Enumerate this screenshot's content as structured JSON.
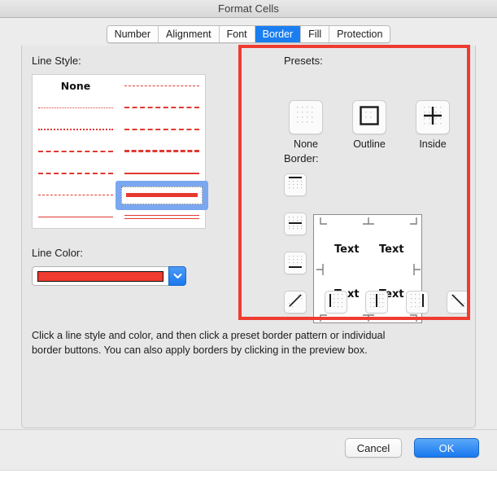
{
  "window": {
    "title": "Format Cells"
  },
  "tabs": [
    {
      "label": "Number",
      "active": false
    },
    {
      "label": "Alignment",
      "active": false
    },
    {
      "label": "Font",
      "active": false
    },
    {
      "label": "Border",
      "active": true
    },
    {
      "label": "Fill",
      "active": false
    },
    {
      "label": "Protection",
      "active": false
    }
  ],
  "line_style": {
    "label": "Line Style:",
    "none_label": "None",
    "selected_index": 11,
    "options": [
      {
        "index": 0,
        "name": "none",
        "style": "none"
      },
      {
        "index": 1,
        "name": "dash-dot-dot-fine",
        "style": "dash-dot-dot"
      },
      {
        "index": 2,
        "name": "dotted-fine",
        "style": "dotted-fine"
      },
      {
        "index": 3,
        "name": "dashed-medium",
        "style": "dashed-medium"
      },
      {
        "index": 4,
        "name": "dotted-medium",
        "style": "dotted-medium"
      },
      {
        "index": 5,
        "name": "dash-dot-fine",
        "style": "dash-dot"
      },
      {
        "index": 6,
        "name": "dash-dot-medium",
        "style": "dash-dot-medium"
      },
      {
        "index": 7,
        "name": "dash-dot-long",
        "style": "dash-dot-long"
      },
      {
        "index": 8,
        "name": "dashed-bold",
        "style": "dashed-bold"
      },
      {
        "index": 9,
        "name": "dashed-fine",
        "style": "dashed-fine"
      },
      {
        "index": 10,
        "name": "solid-medium",
        "style": "solid-medium"
      },
      {
        "index": 11,
        "name": "solid-thick",
        "style": "solid-thick"
      },
      {
        "index": 12,
        "name": "solid-thin",
        "style": "solid-thin"
      },
      {
        "index": 13,
        "name": "double",
        "style": "double"
      }
    ]
  },
  "line_color": {
    "label": "Line Color:",
    "value": "#ef3b30",
    "dropdown_icon": "chevron-down-icon"
  },
  "presets": {
    "label": "Presets:",
    "items": [
      {
        "label": "None",
        "icon": "preset-none-icon"
      },
      {
        "label": "Outline",
        "icon": "preset-outline-icon"
      },
      {
        "label": "Inside",
        "icon": "preset-inside-icon"
      }
    ]
  },
  "border": {
    "label": "Border:",
    "side_buttons": [
      {
        "name": "border-top-button",
        "icon": "border-top-icon"
      },
      {
        "name": "border-inside-horizontal-button",
        "icon": "border-inside-horizontal-icon"
      },
      {
        "name": "border-bottom-button",
        "icon": "border-bottom-icon"
      }
    ],
    "bottom_buttons": [
      {
        "name": "border-diagonal-up-button",
        "icon": "diagonal-up-icon"
      },
      {
        "name": "border-left-button",
        "icon": "border-left-icon"
      },
      {
        "name": "border-inside-vertical-button",
        "icon": "border-inside-vertical-icon"
      },
      {
        "name": "border-right-button",
        "icon": "border-right-icon"
      },
      {
        "name": "border-diagonal-down-button",
        "icon": "diagonal-down-icon"
      }
    ],
    "preview": {
      "cells": [
        "Text",
        "Text",
        "Text",
        "Text"
      ]
    }
  },
  "help_text": "Click a line style and color, and then click a preset border pattern or individual border buttons. You can also apply borders by clicking in the preview box.",
  "footer": {
    "cancel_label": "Cancel",
    "ok_label": "OK"
  },
  "annotation": {
    "color": "#ef3b30",
    "name": "highlight-rectangle"
  }
}
